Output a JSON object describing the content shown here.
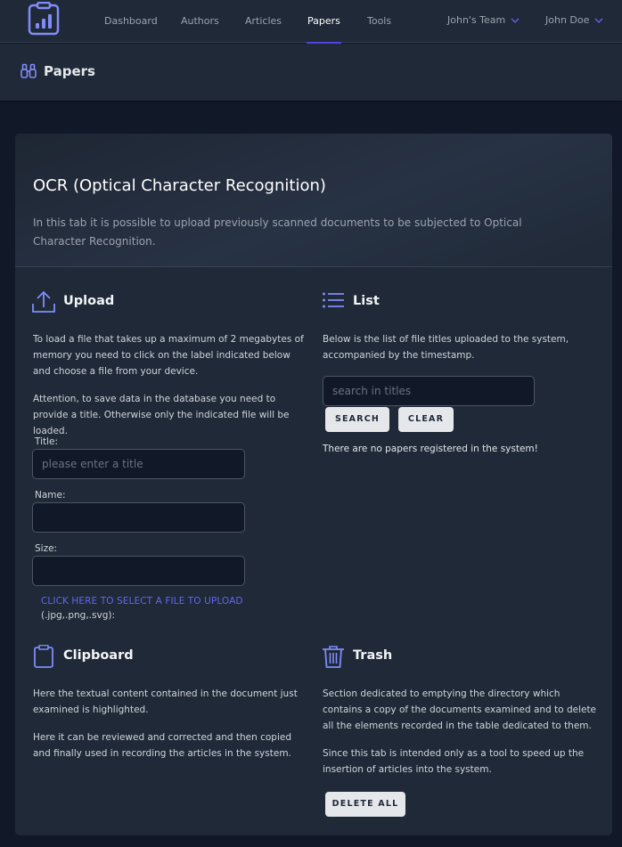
{
  "nav": {
    "links": [
      {
        "label": "Dashboard"
      },
      {
        "label": "Authors"
      },
      {
        "label": "Articles"
      },
      {
        "label": "Papers"
      },
      {
        "label": "Tools"
      }
    ],
    "team": "John's Team",
    "user": "John Doe"
  },
  "header": {
    "title": "Papers"
  },
  "card": {
    "title": "OCR (Optical Character Recognition)",
    "description": "In this tab it is possible to upload previously scanned documents to be subjected to Optical Character Recognition."
  },
  "upload": {
    "title": "Upload",
    "para1": "To load a file that takes up a maximum of 2 megabytes of memory you need to click on the label indicated below and choose a file from your device.",
    "para2": "Attention, to save data in the database you need to provide a title. Otherwise only the indicated file will be loaded.",
    "title_label": "Title:",
    "title_placeholder": "please enter a title",
    "name_label": "Name:",
    "size_label": "Size:",
    "select_link": "CLICK HERE TO SELECT A FILE TO UPLOAD",
    "formats": "(.jpg,.png,.svg):"
  },
  "list": {
    "title": "List",
    "para": "Below is the list of file titles uploaded to the system, accompanied by the timestamp.",
    "search_placeholder": "search in titles",
    "search_button": "SEARCH",
    "clear_button": "CLEAR",
    "empty_message": "There are no papers registered in the system!"
  },
  "clipboard": {
    "title": "Clipboard",
    "para1": "Here the textual content contained in the document just examined is highlighted.",
    "para2": "Here it can be reviewed and corrected and then copied and finally used in recording the articles in the system."
  },
  "trash": {
    "title": "Trash",
    "para1": "Section dedicated to emptying the directory which contains a copy of the documents examined and to delete all the elements recorded in the table dedicated to them.",
    "para2": "Since this tab is intended only as a tool to speed up the insertion of articles into the system.",
    "delete_button": "DELETE ALL"
  },
  "colors": {
    "accent": "#6366f1",
    "background": "#111827",
    "panel": "#1f2937"
  }
}
